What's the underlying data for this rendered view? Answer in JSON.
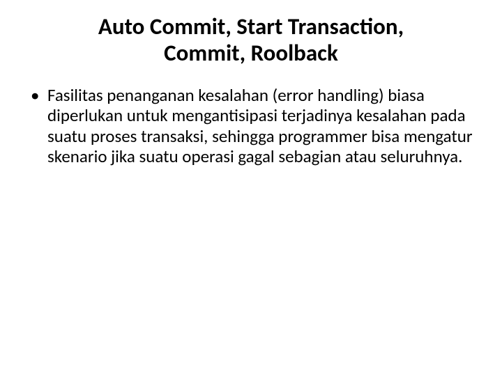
{
  "title_line1": "Auto Commit, Start Transaction,",
  "title_line2": "Commit, Roolback",
  "bullet1": "Fasilitas penanganan kesalahan (error handling) biasa diperlukan untuk mengantisipasi terjadinya kesalahan pada suatu proses transaksi, sehingga programmer bisa mengatur skenario jika suatu operasi gagal sebagian atau seluruhnya."
}
